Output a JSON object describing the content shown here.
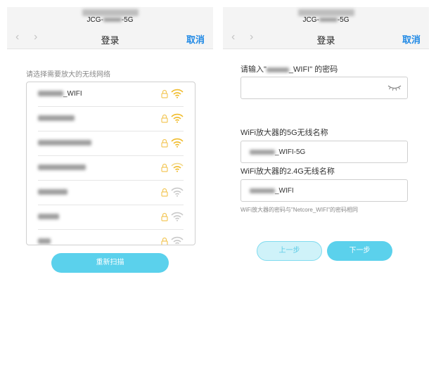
{
  "colors": {
    "accent": "#5bd1ec",
    "link": "#1e88e5",
    "lock": "#f3c85a",
    "wifi_strong": "#f0bb2a",
    "wifi_weak": "#c9c9c9"
  },
  "left": {
    "header": {
      "ssid_prefix": "JCG-",
      "ssid_suffix": "-5G",
      "title": "登录",
      "cancel": "取消"
    },
    "instruction": "请选择需要放大的无线网络",
    "networks": [
      {
        "visible_suffix": "_WIFI",
        "signal": "strong"
      },
      {
        "visible_suffix": "",
        "signal": "strong"
      },
      {
        "visible_suffix": "",
        "signal": "strong"
      },
      {
        "visible_suffix": "",
        "signal": "medium"
      },
      {
        "visible_suffix": "",
        "signal": "weak"
      },
      {
        "visible_suffix": "",
        "signal": "weak"
      },
      {
        "visible_suffix": "",
        "signal": "weak"
      }
    ],
    "rescan_label": "重新扫描"
  },
  "right": {
    "header": {
      "ssid_prefix": "JCG-",
      "ssid_suffix": "-5G",
      "title": "登录",
      "cancel": "取消"
    },
    "password_label_prefix": "请输入\"",
    "password_label_suffix": "_WIFI\" 的密码",
    "label_5g": "WiFi放大器的5G无线名称",
    "value_5g_suffix": "_WIFI-5G",
    "label_24g": "WiFi放大器的2.4G无线名称",
    "value_24g_suffix": "_WIFI",
    "hint": "WiFi放大器的密码与\"Netcore_WIFI\"的密码相同",
    "prev_label": "上一步",
    "next_label": "下一步"
  }
}
